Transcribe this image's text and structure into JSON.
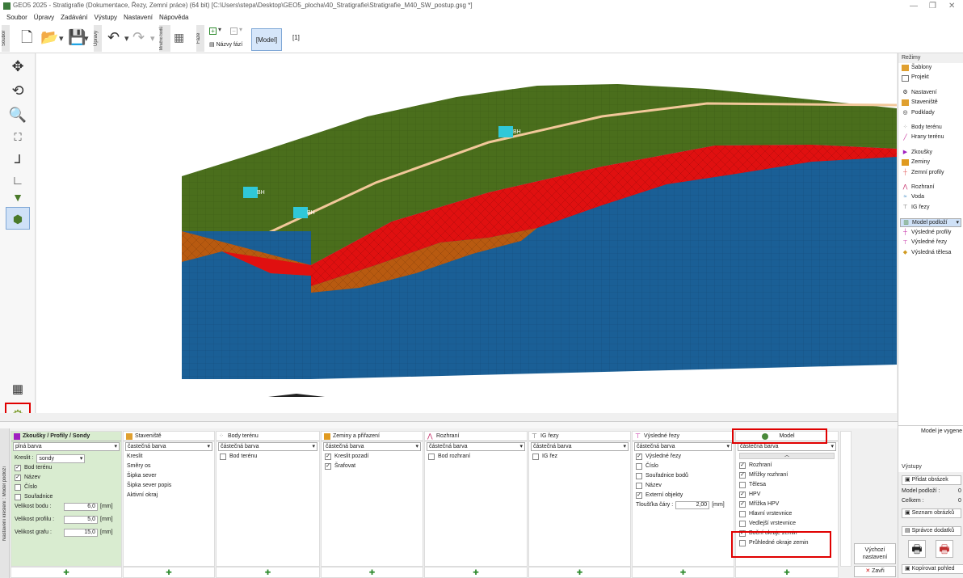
{
  "window": {
    "title": "GEO5 2025 - Stratigrafie (Dokumentace, Řezy, Zemní práce) (64 bit) [C:\\Users\\stepa\\Desktop\\GEO5_plocha\\40_Stratigrafie\\Stratigrafie_M40_SW_postup.gsg *]"
  },
  "menu": [
    "Soubor",
    "Úpravy",
    "Zadávání",
    "Výstupy",
    "Nastavení",
    "Nápověda"
  ],
  "toolbar": {
    "soubor": "Soubor",
    "upravy": "Úpravy",
    "mracno": "Mračno bodů",
    "faze": "Fáze",
    "nazvy_fazi": "Názvy fází",
    "model_btn": "[Model]",
    "phase_index": "[1]"
  },
  "canvas": {
    "bh_labels": [
      "BH",
      "BH",
      "BH"
    ]
  },
  "regimes": {
    "title": "Režimy",
    "items": [
      {
        "label": "Šablony",
        "icon": "templates-icon",
        "color": "#e0a030"
      },
      {
        "label": "Projekt",
        "icon": "project-icon",
        "color": "#777"
      },
      {
        "label": "Nastavení",
        "icon": "settings-icon",
        "color": "#555"
      },
      {
        "label": "Staveniště",
        "icon": "site-icon",
        "color": "#e0a030"
      },
      {
        "label": "Podklady",
        "icon": "background-icon",
        "color": "#666"
      },
      {
        "label": "Body terénu",
        "icon": "terrain-points-icon",
        "color": "#888"
      },
      {
        "label": "Hrany terénu",
        "icon": "terrain-edges-icon",
        "color": "#c02090"
      },
      {
        "label": "Zkoušky",
        "icon": "tests-icon",
        "color": "#a020c0"
      },
      {
        "label": "Zeminy",
        "icon": "soils-icon",
        "color": "#e09a20"
      },
      {
        "label": "Zemní profily",
        "icon": "soil-profiles-icon",
        "color": "#e05050"
      },
      {
        "label": "Rozhraní",
        "icon": "interfaces-icon",
        "color": "#c02060"
      },
      {
        "label": "Voda",
        "icon": "water-icon",
        "color": "#3080c0"
      },
      {
        "label": "IG řezy",
        "icon": "ig-sections-icon",
        "color": "#666"
      },
      {
        "label": "Model podloží",
        "icon": "subsoil-model-icon",
        "color": "#4a8a3a"
      },
      {
        "label": "Výsledné profily",
        "icon": "result-profiles-icon",
        "color": "#c020a0"
      },
      {
        "label": "Výsledné řezy",
        "icon": "result-sections-icon",
        "color": "#c020a0"
      },
      {
        "label": "Výsledná tělesa",
        "icon": "result-bodies-icon",
        "color": "#d09a20"
      }
    ],
    "status": "Model je vygene"
  },
  "outputs": {
    "title": "Výstupy",
    "add_image": "Přidat obrázek",
    "model_podlozi": "Model podloží :",
    "model_podlozi_val": "0",
    "celkem": "Celkem :",
    "celkem_val": "0",
    "list_images": "Seznam obrázků",
    "appendix_manager": "Správce dodatků",
    "copy_view": "Kopírovat pohled"
  },
  "bottom": {
    "side_tab": "Nastavení kreslení : Model podloží",
    "default_settings": "Výchozí nastavení",
    "close": "Zavři",
    "columns": [
      {
        "title": "Zkoušky / Profily / Sondy",
        "select": "plná barva",
        "kreslit_label": "Kreslit :",
        "kreslit_value": "sondy",
        "checks": [
          {
            "label": "Bod terénu",
            "checked": true
          },
          {
            "label": "Název",
            "checked": true
          },
          {
            "label": "Číslo",
            "checked": false
          },
          {
            "label": "Souřadnice",
            "checked": false
          }
        ],
        "fields": [
          {
            "label": "Velikost bodu :",
            "value": "6,0",
            "unit": "[mm]"
          },
          {
            "label": "Velikost profilu :",
            "value": "5,0",
            "unit": "[mm]"
          },
          {
            "label": "Velikost grafu :",
            "value": "15,0",
            "unit": "[mm]"
          }
        ]
      },
      {
        "title": "Staveniště",
        "select": "častečná barva",
        "rows": [
          "Kreslit",
          "Směry os",
          "Šipka sever",
          "Šipka sever popis",
          "Aktivní okraj"
        ]
      },
      {
        "title": "Body terénu",
        "select": "částečná barva",
        "checks": [
          {
            "label": "Bod terénu",
            "checked": false
          }
        ]
      },
      {
        "title": "Zeminy a přiřazení",
        "select": "částečná barva",
        "checks": [
          {
            "label": "Kreslit pozadí",
            "checked": true
          },
          {
            "label": "Šrafovat",
            "checked": true
          }
        ]
      },
      {
        "title": "Rozhraní",
        "select": "částečná barva",
        "checks": [
          {
            "label": "Bod rozhraní",
            "checked": false
          }
        ]
      },
      {
        "title": "IG řezy",
        "select": "částečná barva",
        "checks": [
          {
            "label": "IG řez",
            "checked": false
          }
        ]
      },
      {
        "title": "Výsledné řezy",
        "select": "částečná barva",
        "checks": [
          {
            "label": "Výsledné řezy",
            "checked": true
          },
          {
            "label": "Číslo",
            "checked": false
          },
          {
            "label": "Souřadnice bodů",
            "checked": false
          },
          {
            "label": "Název",
            "checked": false
          },
          {
            "label": "Externí objekty",
            "checked": true
          }
        ],
        "line_label": "Tloušťka čáry :",
        "line_value": "2,00",
        "line_unit": "[mm]"
      },
      {
        "title": "Model",
        "select": "částečná barva",
        "checks": [
          {
            "label": "Rozhraní",
            "checked": true
          },
          {
            "label": "Mřížky rozhraní",
            "checked": true
          },
          {
            "label": "Tělesa",
            "checked": false
          },
          {
            "label": "HPV",
            "checked": true
          },
          {
            "label": "Mřížka HPV",
            "checked": true
          },
          {
            "label": "Hlavní vrstevnice",
            "checked": false
          },
          {
            "label": "Vedlejší vrstevnice",
            "checked": false
          },
          {
            "label": "Boční okraje zemin",
            "checked": true
          },
          {
            "label": "Průhledné okraje zemin",
            "checked": false
          }
        ]
      }
    ]
  },
  "colors": {
    "green_top": "#4a6e1c",
    "red_layer": "#e01010",
    "brown_layer": "#b85a10",
    "blue_layer": "#1a5f96",
    "highlight": "#e00000"
  }
}
